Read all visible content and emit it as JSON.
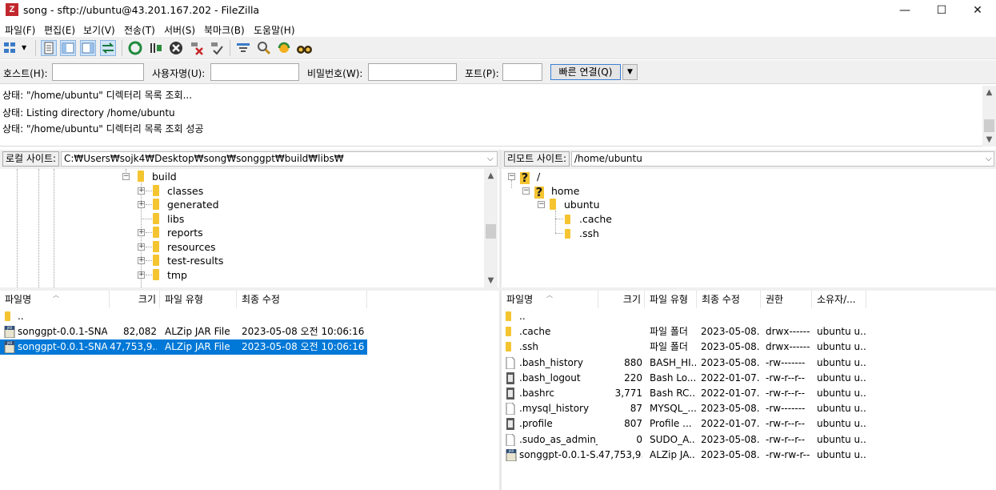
{
  "window": {
    "app_icon": "filezilla-icon",
    "title": "song - sftp://ubuntu@43.201.167.202 - FileZilla",
    "minimize": "—",
    "maximize": "☐",
    "close": "✕"
  },
  "menu": [
    "파일(F)",
    "편집(E)",
    "보기(V)",
    "전송(T)",
    "서버(S)",
    "북마크(B)",
    "도움말(H)"
  ],
  "quickconnect": {
    "host_label": "호스트(H):",
    "user_label": "사용자명(U):",
    "pass_label": "비밀번호(W):",
    "port_label": "포트(P):",
    "host_value": "",
    "user_value": "",
    "pass_value": "",
    "port_value": "",
    "connect_label": "빠른 연결(Q)"
  },
  "log": [
    "상태:  \"/home/ubuntu\" 디렉터리 목록 조회...",
    "상태:  Listing directory /home/ubuntu",
    "상태:  \"/home/ubuntu\" 디렉터리 목록 조회 성공"
  ],
  "local": {
    "site_label": "로컬 사이트:",
    "path": "C:₩Users₩sojk4₩Desktop₩song₩songgpt₩build₩libs₩",
    "tree": {
      "root": "build",
      "children": [
        "classes",
        "generated",
        "libs",
        "reports",
        "resources",
        "test-results",
        "tmp"
      ]
    },
    "columns": [
      "파일명",
      "크기",
      "파일 유형",
      "최종 수정"
    ],
    "files": [
      {
        "name": "..",
        "size": "",
        "type": "",
        "modified": ""
      },
      {
        "name": "songgpt-0.0.1-SNA...",
        "size": "82,082",
        "type": "ALZip JAR File",
        "modified": "2023-05-08 오전 10:06:16"
      },
      {
        "name": "songgpt-0.0.1-SNA...",
        "size": "47,753,9...",
        "type": "ALZip JAR File",
        "modified": "2023-05-08 오전 10:06:16"
      }
    ],
    "selected_row": 2
  },
  "remote": {
    "site_label": "리모트 사이트:",
    "path": "/home/ubuntu",
    "tree": {
      "root": "/",
      "home": "home",
      "ubuntu": "ubuntu",
      "children": [
        ".cache",
        ".ssh"
      ]
    },
    "columns": [
      "파일명",
      "크기",
      "파일 유형",
      "최종 수정",
      "권한",
      "소유자/..."
    ],
    "files": [
      {
        "name": "..",
        "size": "",
        "type": "",
        "modified": "",
        "perms": "",
        "owner": "",
        "icon": "folder"
      },
      {
        "name": ".cache",
        "size": "",
        "type": "파일 폴더",
        "modified": "2023-05-08...",
        "perms": "drwx------",
        "owner": "ubuntu u...",
        "icon": "folder"
      },
      {
        "name": ".ssh",
        "size": "",
        "type": "파일 폴더",
        "modified": "2023-05-08...",
        "perms": "drwx------",
        "owner": "ubuntu u...",
        "icon": "folder"
      },
      {
        "name": ".bash_history",
        "size": "880",
        "type": "BASH_HI...",
        "modified": "2023-05-08...",
        "perms": "-rw-------",
        "owner": "ubuntu u...",
        "icon": "file"
      },
      {
        "name": ".bash_logout",
        "size": "220",
        "type": "Bash Lo...",
        "modified": "2022-01-07...",
        "perms": "-rw-r--r--",
        "owner": "ubuntu u...",
        "icon": "doc"
      },
      {
        "name": ".bashrc",
        "size": "3,771",
        "type": "Bash RC...",
        "modified": "2022-01-07...",
        "perms": "-rw-r--r--",
        "owner": "ubuntu u...",
        "icon": "doc"
      },
      {
        "name": ".mysql_history",
        "size": "87",
        "type": "MYSQL_...",
        "modified": "2023-05-08...",
        "perms": "-rw-------",
        "owner": "ubuntu u...",
        "icon": "file"
      },
      {
        "name": ".profile",
        "size": "807",
        "type": "Profile ...",
        "modified": "2022-01-07...",
        "perms": "-rw-r--r--",
        "owner": "ubuntu u...",
        "icon": "doc"
      },
      {
        "name": ".sudo_as_admin_...",
        "size": "0",
        "type": "SUDO_A...",
        "modified": "2023-05-08...",
        "perms": "-rw-r--r--",
        "owner": "ubuntu u...",
        "icon": "file"
      },
      {
        "name": "songgpt-0.0.1-S...",
        "size": "47,753,9...",
        "type": "ALZip JA...",
        "modified": "2023-05-08...",
        "perms": "-rw-rw-r--",
        "owner": "ubuntu u...",
        "icon": "jar"
      }
    ]
  }
}
